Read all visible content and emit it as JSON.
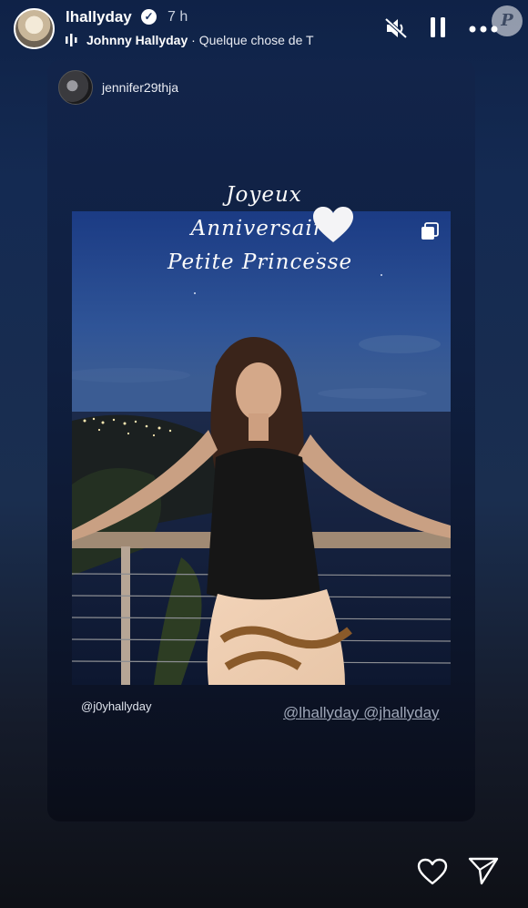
{
  "header": {
    "username": "lhallyday",
    "time": "7 h",
    "music_artist": "Johnny Hallyday",
    "music_separator": " · ",
    "music_song": "Quelque chose de T"
  },
  "watermark": "P",
  "repost": {
    "username": "jennifer29thja",
    "greeting_line1": "Joyeux Anniversaire",
    "greeting_line2": "Petite Princesse",
    "handle": "@j0yhallyday",
    "tags": "@lhallyday @jhallyday"
  },
  "icons": [
    "verified-icon",
    "music-bars-icon",
    "mute-icon",
    "pause-icon",
    "more-icon",
    "heart-emoji-icon",
    "carousel-icon",
    "heart-icon",
    "send-icon"
  ]
}
